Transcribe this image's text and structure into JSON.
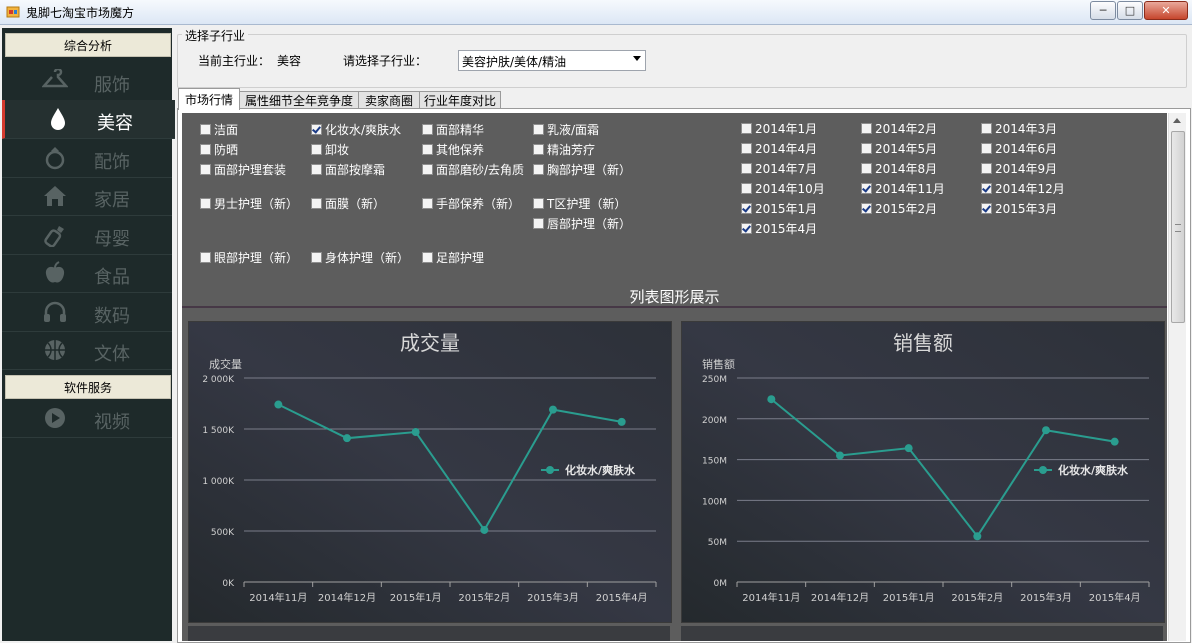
{
  "window": {
    "title": "鬼脚七淘宝市场魔方",
    "min_label": "─",
    "max_label": "□",
    "close_label": "✕"
  },
  "sidebar": {
    "section1": "综合分析",
    "items": [
      {
        "label": "服饰",
        "icon": "hanger-icon"
      },
      {
        "label": "美容",
        "icon": "droplet-icon",
        "active": true
      },
      {
        "label": "配饰",
        "icon": "ring-icon"
      },
      {
        "label": "家居",
        "icon": "home-icon"
      },
      {
        "label": "母婴",
        "icon": "baby-bottle-icon"
      },
      {
        "label": "食品",
        "icon": "apple-icon"
      },
      {
        "label": "数码",
        "icon": "headphones-icon"
      },
      {
        "label": "文体",
        "icon": "basketball-icon"
      }
    ],
    "section2": "软件服务",
    "items2": [
      {
        "label": "视频",
        "icon": "play-icon"
      }
    ]
  },
  "selector": {
    "group_title": "选择子行业",
    "main_industry_label": "当前主行业：",
    "main_industry_value": "美容",
    "sub_label": "请选择子行业：",
    "sub_value": "美容护肤/美体/精油"
  },
  "tabs": [
    "市场行情",
    "属性细节全年竞争度",
    "卖家商圈",
    "行业年度对比"
  ],
  "categories": [
    {
      "label": "洁面",
      "checked": false
    },
    {
      "label": "化妆水/爽肤水",
      "checked": true
    },
    {
      "label": "面部精华",
      "checked": false
    },
    {
      "label": "乳液/面霜",
      "checked": false
    },
    {
      "label": "防晒",
      "checked": false
    },
    {
      "label": "卸妆",
      "checked": false
    },
    {
      "label": "其他保养",
      "checked": false
    },
    {
      "label": "精油芳疗",
      "checked": false
    },
    {
      "label": "面部护理套装",
      "checked": false
    },
    {
      "label": "面部按摩霜",
      "checked": false
    },
    {
      "label": "面部磨砂/去角质",
      "checked": false
    },
    {
      "label": "胸部护理（新）",
      "checked": false
    },
    {
      "label": "男士护理（新）",
      "checked": false
    },
    {
      "label": "面膜（新）",
      "checked": false
    },
    {
      "label": "手部保养（新）",
      "checked": false
    },
    {
      "label": "T区护理（新）",
      "checked": false
    },
    {
      "label": "唇部护理（新）",
      "checked": false
    },
    {
      "label": "眼部护理（新）",
      "checked": false
    },
    {
      "label": "身体护理（新）",
      "checked": false
    },
    {
      "label": "足部护理",
      "checked": false
    }
  ],
  "months": [
    {
      "label": "2014年1月",
      "checked": false
    },
    {
      "label": "2014年2月",
      "checked": false
    },
    {
      "label": "2014年3月",
      "checked": false
    },
    {
      "label": "2014年4月",
      "checked": false
    },
    {
      "label": "2014年5月",
      "checked": false
    },
    {
      "label": "2014年6月",
      "checked": false
    },
    {
      "label": "2014年7月",
      "checked": false
    },
    {
      "label": "2014年8月",
      "checked": false
    },
    {
      "label": "2014年9月",
      "checked": false
    },
    {
      "label": "2014年10月",
      "checked": false
    },
    {
      "label": "2014年11月",
      "checked": true
    },
    {
      "label": "2014年12月",
      "checked": true
    },
    {
      "label": "2015年1月",
      "checked": true
    },
    {
      "label": "2015年2月",
      "checked": true
    },
    {
      "label": "2015年3月",
      "checked": true
    },
    {
      "label": "2015年4月",
      "checked": true
    }
  ],
  "section_title": "列表图形展示",
  "colors": {
    "series": "#2a9d8f",
    "chart_bg": "#272b30"
  },
  "chart_data": [
    {
      "type": "line",
      "title": "成交量",
      "ylabel": "成交量",
      "categories": [
        "2014年11月",
        "2014年12月",
        "2015年1月",
        "2015年2月",
        "2015年3月",
        "2015年4月"
      ],
      "series": [
        {
          "name": "化妆水/爽肤水",
          "values": [
            1740000,
            1410000,
            1470000,
            510000,
            1690000,
            1570000
          ]
        }
      ],
      "ylim": [
        0,
        2000000
      ],
      "yticks": [
        0,
        500000,
        1000000,
        1500000,
        2000000
      ],
      "ytick_labels": [
        "0K",
        "500K",
        "1 000K",
        "1 500K",
        "2 000K"
      ],
      "legend": "right"
    },
    {
      "type": "line",
      "title": "销售额",
      "ylabel": "销售额",
      "categories": [
        "2014年11月",
        "2014年12月",
        "2015年1月",
        "2015年2月",
        "2015年3月",
        "2015年4月"
      ],
      "series": [
        {
          "name": "化妆水/爽肤水",
          "values": [
            224000000,
            155000000,
            164000000,
            56000000,
            186000000,
            172000000
          ]
        }
      ],
      "ylim": [
        0,
        250000000
      ],
      "yticks": [
        0,
        50000000,
        100000000,
        150000000,
        200000000,
        250000000
      ],
      "ytick_labels": [
        "0M",
        "50M",
        "100M",
        "150M",
        "200M",
        "250M"
      ],
      "legend": "right"
    }
  ]
}
